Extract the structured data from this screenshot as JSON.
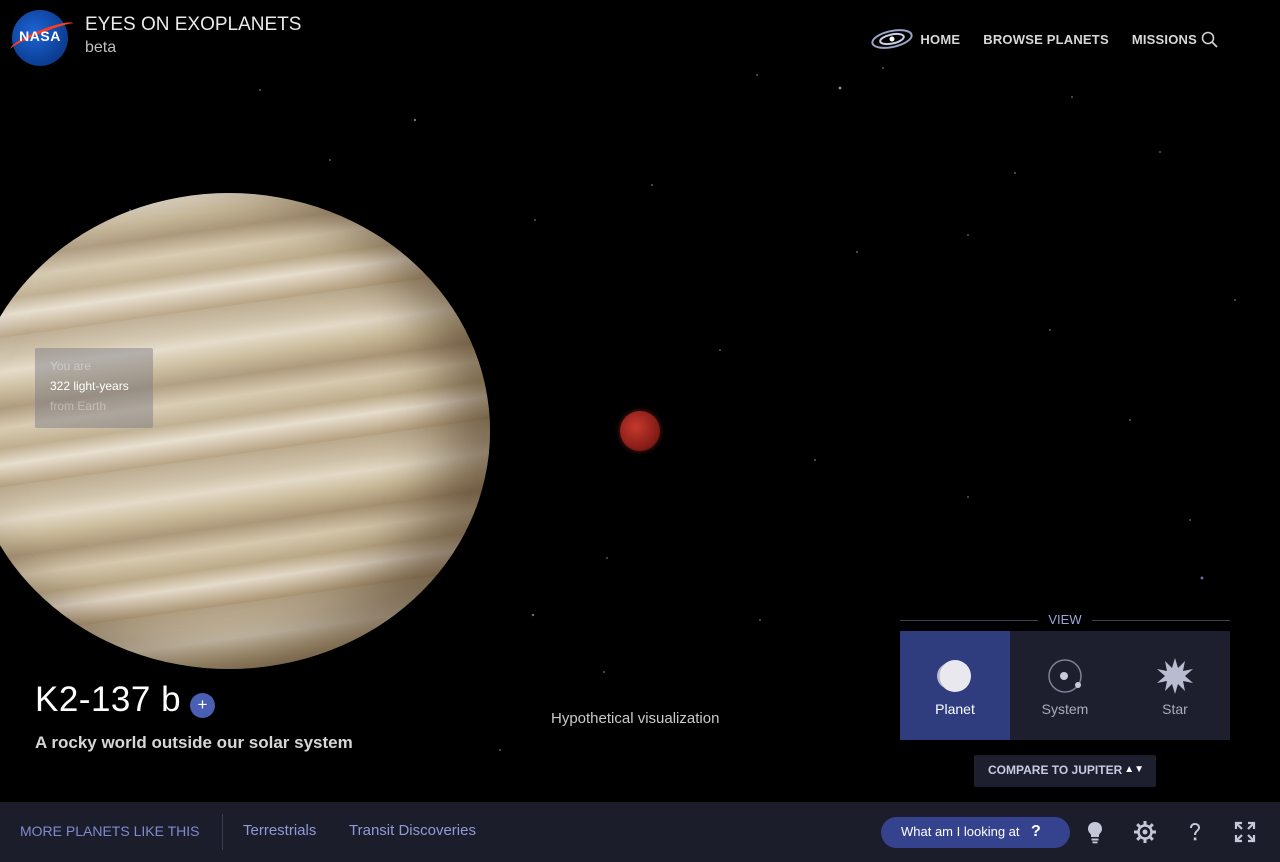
{
  "header": {
    "logo_text": "NASA",
    "title": "EYES ON EXOPLANETS",
    "subtitle": "beta",
    "nav": [
      "HOME",
      "BROWSE PLANETS",
      "MISSIONS"
    ]
  },
  "distance": {
    "line1": "You are",
    "line2": "322 light-years",
    "line3": "from Earth"
  },
  "planet": {
    "name": "K2-137 b",
    "add_label": "+",
    "tagline": "A rocky world outside our solar system"
  },
  "visualization_note": "Hypothetical visualization",
  "view_panel": {
    "label": "VIEW",
    "options": [
      "Planet",
      "System",
      "Star"
    ],
    "selected": "Planet"
  },
  "compare": {
    "label": "COMPARE TO JUPITER",
    "arrows": "▲▼"
  },
  "bottom_bar": {
    "more_label": "MORE PLANETS LIKE THIS",
    "links": [
      "Terrestrials",
      "Transit Discoveries"
    ],
    "help_button": "What am I looking at",
    "help_glyph": "?"
  },
  "colors": {
    "accent": "#35438f",
    "active_view": "#2f3c7d",
    "bar_bg": "#1c1d2b",
    "link": "#8f9ad8"
  }
}
